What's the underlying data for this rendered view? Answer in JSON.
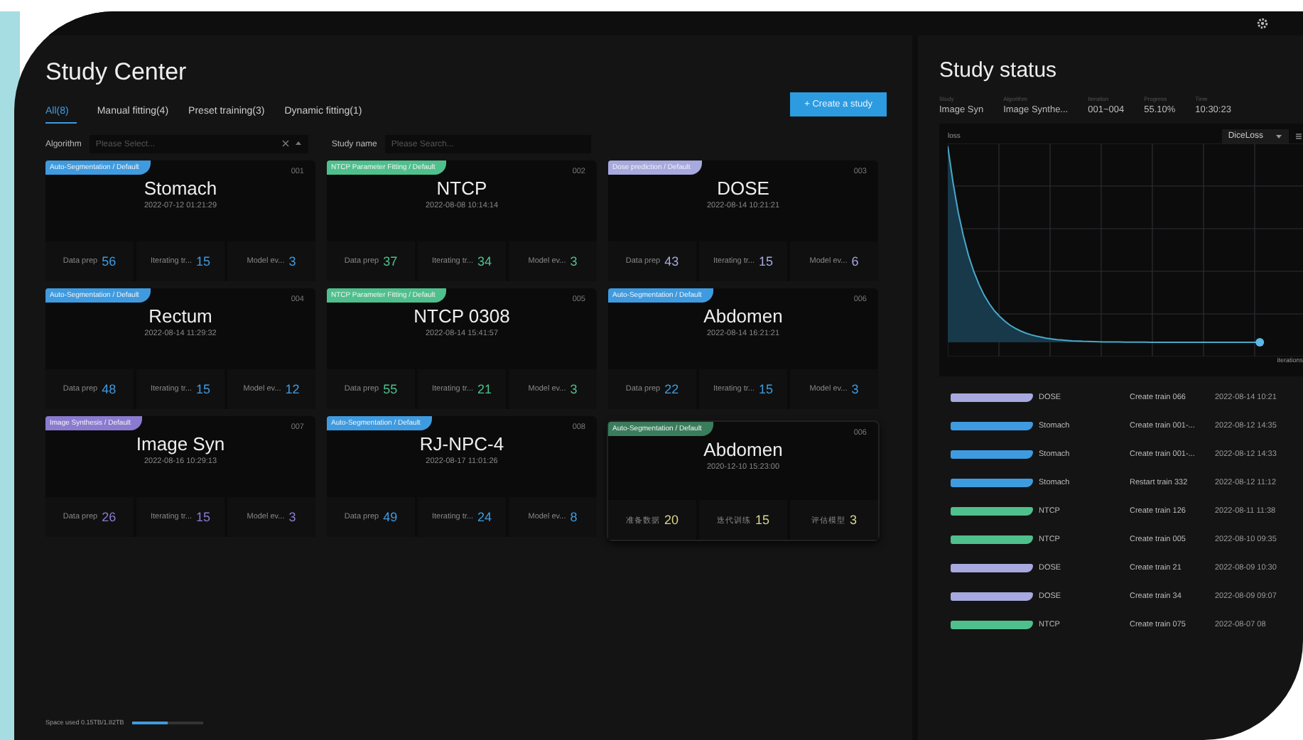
{
  "title": "Study Center",
  "tabs": [
    {
      "label": "All(8)",
      "selected": true
    },
    {
      "label": "Manual fitting(4)",
      "selected": false
    },
    {
      "label": "Preset training(3)",
      "selected": false
    },
    {
      "label": "Dynamic fitting(1)",
      "selected": false
    }
  ],
  "create_button": "+ Create a study",
  "filters": [
    {
      "label": "Algorithm",
      "placeholder": "Please Select...",
      "kind": "select"
    },
    {
      "label": "Study name",
      "placeholder": "Please Search...",
      "kind": "search"
    }
  ],
  "cards": [
    {
      "tag": "Auto-Segmentation / Default",
      "color": "#3f9be0",
      "number": "001",
      "name": "Stomach",
      "date": "2022-07-12 01:21:29",
      "selected": false,
      "stats": [
        {
          "label": "Data prep",
          "value": "56"
        },
        {
          "label": "Iterating tr...",
          "value": "15"
        },
        {
          "label": "Model ev...",
          "value": "3"
        }
      ]
    },
    {
      "tag": "NTCP Parameter Fitting / Default",
      "color": "#4fc08d",
      "number": "002",
      "name": "NTCP",
      "date": "2022-08-08 10:14:14",
      "selected": false,
      "stats": [
        {
          "label": "Data prep",
          "value": "37"
        },
        {
          "label": "Iterating tr...",
          "value": "34"
        },
        {
          "label": "Model ev...",
          "value": "3"
        }
      ]
    },
    {
      "tag": "Dose prediction / Default",
      "color": "#a7a9df",
      "number": "003",
      "name": "DOSE",
      "date": "2022-08-14 10:21:21",
      "selected": false,
      "stats": [
        {
          "label": "Data prep",
          "value": "43"
        },
        {
          "label": "Iterating tr...",
          "value": "15"
        },
        {
          "label": "Model ev...",
          "value": "6"
        }
      ]
    },
    {
      "tag": "Auto-Segmentation / Default",
      "color": "#3f9be0",
      "number": "004",
      "name": "Rectum",
      "date": "2022-08-14 11:29:32",
      "selected": false,
      "stats": [
        {
          "label": "Data prep",
          "value": "48"
        },
        {
          "label": "Iterating tr...",
          "value": "15"
        },
        {
          "label": "Model ev...",
          "value": "12"
        }
      ]
    },
    {
      "tag": "NTCP Parameter Fitting / Default",
      "color": "#4fc08d",
      "number": "005",
      "name": "NTCP 0308",
      "date": "2022-08-14 15:41:57",
      "selected": false,
      "stats": [
        {
          "label": "Data prep",
          "value": "55"
        },
        {
          "label": "Iterating tr...",
          "value": "21"
        },
        {
          "label": "Model ev...",
          "value": "3"
        }
      ]
    },
    {
      "tag": "Auto-Segmentation / Default",
      "color": "#3f9be0",
      "number": "006",
      "name": "Abdomen",
      "date": "2022-08-14 16:21:21",
      "selected": false,
      "stats": [
        {
          "label": "Data prep",
          "value": "22"
        },
        {
          "label": "Iterating tr...",
          "value": "15"
        },
        {
          "label": "Model ev...",
          "value": "3"
        }
      ]
    },
    {
      "tag": "Image Synthesis / Default",
      "color": "#8b7bd0",
      "number": "007",
      "name": "Image Syn",
      "date": "2022-08-16 10:29:13",
      "selected": false,
      "stats": [
        {
          "label": "Data prep",
          "value": "26"
        },
        {
          "label": "Iterating tr...",
          "value": "15"
        },
        {
          "label": "Model ev...",
          "value": "3"
        }
      ]
    },
    {
      "tag": "Auto-Segmentation / Default",
      "color": "#3f9be0",
      "number": "008",
      "name": "RJ-NPC-4",
      "date": "2022-08-17 11:01:26",
      "selected": false,
      "stats": [
        {
          "label": "Data prep",
          "value": "49"
        },
        {
          "label": "Iterating tr...",
          "value": "24"
        },
        {
          "label": "Model ev...",
          "value": "8"
        }
      ]
    },
    {
      "tag": "Auto-Segmentation / Default",
      "color": "#3a7d5c",
      "number": "006",
      "name": "Abdomen",
      "date": "2020-12-10 15:23:00",
      "selected": true,
      "stats": [
        {
          "label": "准备数据",
          "value": "20"
        },
        {
          "label": "迭代训练",
          "value": "15"
        },
        {
          "label": "评估模型",
          "value": "3"
        }
      ]
    }
  ],
  "storage": {
    "label": "Space used 0.15TB/1.82TB",
    "level": 0.5
  },
  "status": {
    "title": "Study status",
    "fields": [
      {
        "label": "Study",
        "value": "Image Syn"
      },
      {
        "label": "Algorithm",
        "value": "Image Synthe..."
      },
      {
        "label": "Iteration",
        "value": "001~004"
      },
      {
        "label": "Progress",
        "value": "55.10%"
      },
      {
        "label": "Time",
        "value": "10:30:23"
      }
    ],
    "chart": {
      "ylabel": "loss",
      "xlabel": "iterations",
      "metric": "DiceLoss"
    },
    "events": [
      {
        "color": "#a7a9df",
        "study": "DOSE",
        "action": "Create train 066",
        "time": "2022-08-14 10:21"
      },
      {
        "color": "#3f9be0",
        "study": "Stomach",
        "action": "Create train 001-...",
        "time": "2022-08-12 14:35"
      },
      {
        "color": "#3f9be0",
        "study": "Stomach",
        "action": "Create train 001-...",
        "time": "2022-08-12 14:33"
      },
      {
        "color": "#3f9be0",
        "study": "Stomach",
        "action": "Restart train 332",
        "time": "2022-08-12 11:12"
      },
      {
        "color": "#4fc08d",
        "study": "NTCP",
        "action": "Create train 126",
        "time": "2022-08-11 11:38"
      },
      {
        "color": "#4fc08d",
        "study": "NTCP",
        "action": "Create train 005",
        "time": "2022-08-10 09:35"
      },
      {
        "color": "#a7a9df",
        "study": "DOSE",
        "action": "Create train 21",
        "time": "2022-08-09 10:30"
      },
      {
        "color": "#a7a9df",
        "study": "DOSE",
        "action": "Create train 34",
        "time": "2022-08-09 09:07"
      },
      {
        "color": "#4fc08d",
        "study": "NTCP",
        "action": "Create train 075",
        "time": "2022-08-07 08"
      }
    ]
  }
}
